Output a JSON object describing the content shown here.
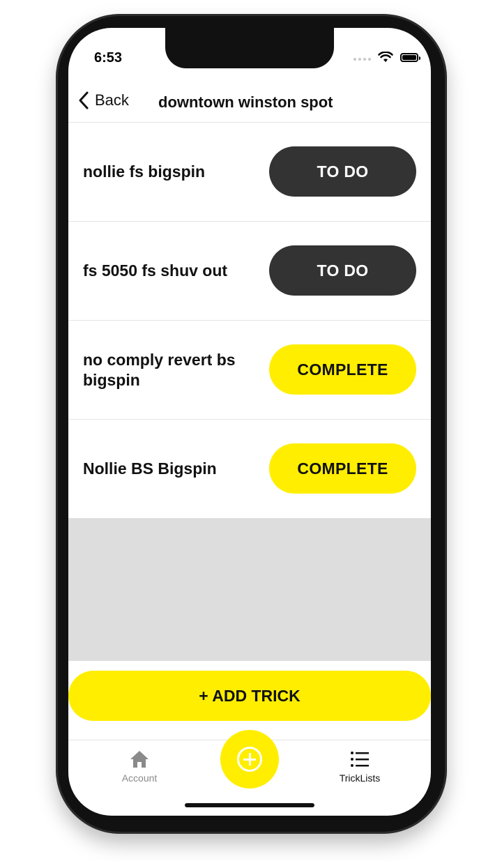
{
  "status_bar": {
    "time": "6:53"
  },
  "nav": {
    "back_label": "Back",
    "title": "downtown winston spot"
  },
  "tricks": [
    {
      "name": "nollie fs bigspin",
      "status": "TO DO"
    },
    {
      "name": "fs 5050 fs shuv out",
      "status": "TO DO"
    },
    {
      "name": "no comply revert bs bigspin",
      "status": "COMPLETE"
    },
    {
      "name": "Nollie BS Bigspin",
      "status": "COMPLETE"
    }
  ],
  "add_button_label": "+ ADD TRICK",
  "tabbar": {
    "account_label": "Account",
    "lists_label": "TrickLists"
  },
  "colors": {
    "accent": "#ffee00",
    "todo": "#333333",
    "empty_area": "#dddddd"
  },
  "icons": [
    "chevron-left-icon",
    "wifi-icon",
    "battery-icon",
    "home-icon",
    "plus-circle-icon",
    "list-icon"
  ]
}
